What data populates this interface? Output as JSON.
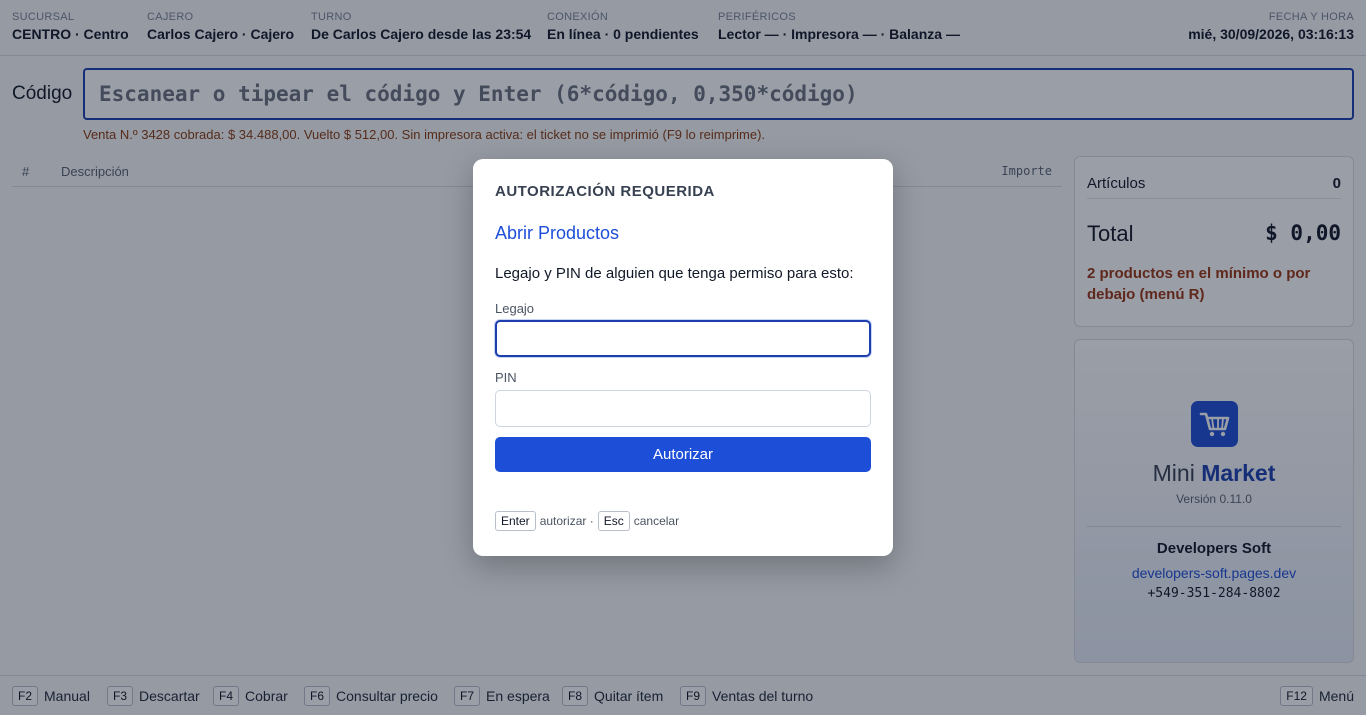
{
  "header": {
    "branch": {
      "label": "SUCURSAL",
      "value": "CENTRO · Centro"
    },
    "cashier": {
      "label": "CAJERO",
      "value": "Carlos Cajero · Cajero"
    },
    "shift": {
      "label": "TURNO",
      "value": "De Carlos Cajero desde las 23:54"
    },
    "connection": {
      "label": "CONEXIÓN",
      "value": "En línea · 0 pendientes"
    },
    "peripherals": {
      "label": "PERIFÉRICOS",
      "value": "Lector — · Impresora — · Balanza —"
    },
    "datetime": {
      "label": "FECHA Y HORA",
      "value": "mié, 30/09/2026, 03:16:13"
    }
  },
  "code": {
    "label": "Código",
    "placeholder": "Escanear o tipear el código y Enter (6*código, 0,350*código)"
  },
  "status_message": "Venta N.º 3428 cobrada: $ 34.488,00. Vuelto $ 512,00. Sin impresora activa: el ticket no se imprimió (F9 lo reimprime).",
  "table": {
    "columns": [
      "#",
      "Descripción",
      "Importe"
    ]
  },
  "summary": {
    "items_label": "Artículos",
    "items_value": "0",
    "total_label": "Total",
    "total_value": "$ 0,00",
    "warning": "2 productos en el mínimo o por debajo (menú R)"
  },
  "brand": {
    "name_light": "Mini",
    "name_bold": "Market",
    "version": "Versión 0.11.0",
    "developer": "Developers Soft",
    "url": "developers-soft.pages.dev",
    "phone": "+549-351-284-8802",
    "icon": "shopping-cart-icon",
    "color": "#1e4fd8"
  },
  "footer": {
    "keys": [
      {
        "key": "F2",
        "label": "Manual"
      },
      {
        "key": "F3",
        "label": "Descartar"
      },
      {
        "key": "F4",
        "label": "Cobrar"
      },
      {
        "key": "F6",
        "label": "Consultar precio"
      },
      {
        "key": "F7",
        "label": "En espera"
      },
      {
        "key": "F8",
        "label": "Quitar ítem"
      },
      {
        "key": "F9",
        "label": "Ventas del turno"
      },
      {
        "key": "F12",
        "label": "Menú"
      }
    ]
  },
  "modal": {
    "title": "AUTORIZACIÓN REQUERIDA",
    "subtitle": "Abrir Productos",
    "description": "Legajo y PIN de alguien que tenga permiso para esto:",
    "legajo_label": "Legajo",
    "legajo_value": "",
    "pin_label": "PIN",
    "pin_value": "",
    "button": "Autorizar",
    "hint_enter_key": "Enter",
    "hint_enter_text": "autorizar ·",
    "hint_esc_key": "Esc",
    "hint_esc_text": "cancelar",
    "accent": "#1d4ed8"
  }
}
